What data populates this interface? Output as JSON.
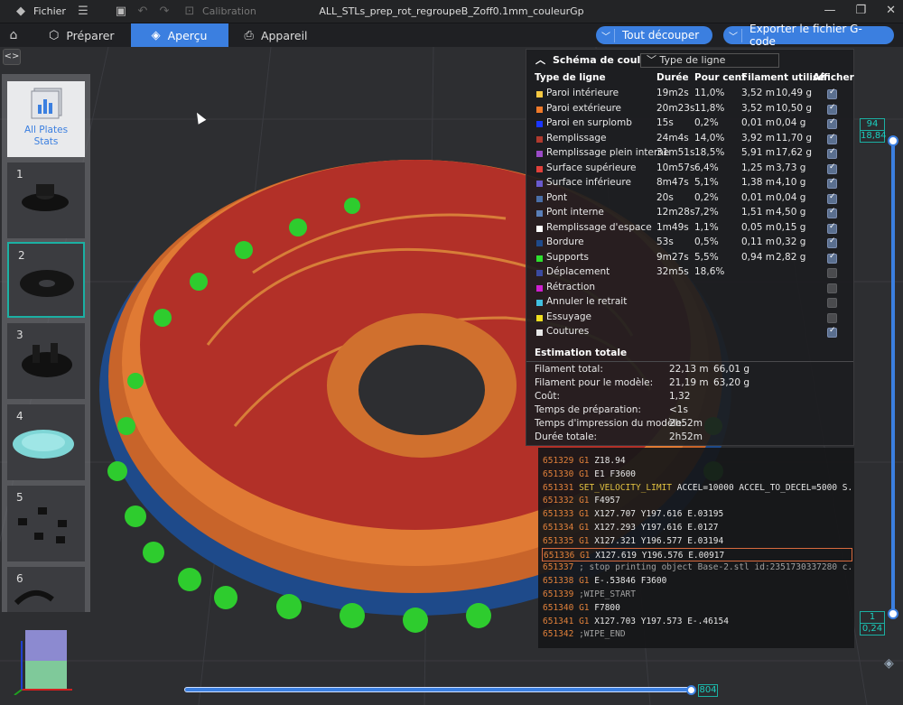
{
  "titlebar": {
    "menu_label": "Fichier",
    "calibration_label": "Calibration",
    "window_title": "ALL_STLs_prep_rot_regroupeB_Zoff0.1mm_couleurGp"
  },
  "tabs": [
    {
      "label": "Préparer",
      "icon": "cube-icon"
    },
    {
      "label": "Aperçu",
      "icon": "layers-icon"
    },
    {
      "label": "Appareil",
      "icon": "printer-icon"
    }
  ],
  "actions": {
    "slice_all": "Tout découper",
    "export_gcode": "Exporter le fichier G-code"
  },
  "plates": {
    "stats_label_1": "All Plates",
    "stats_label_2": "Stats",
    "items": [
      "1",
      "2",
      "3",
      "4",
      "5",
      "6"
    ],
    "selected": "2"
  },
  "legend": {
    "title": "Schéma de couleur",
    "view_mode": "Type de ligne",
    "columns": [
      "Type de ligne",
      "Durée",
      "Pour cent",
      "Filament utilisé",
      "Afficher"
    ],
    "rows": [
      {
        "name": "Paroi intérieure",
        "color": "#f5c842",
        "time": "19m2s",
        "pct": "11,0%",
        "len": "3,52 m",
        "weight": "10,49 g",
        "shown": true
      },
      {
        "name": "Paroi extérieure",
        "color": "#f07a2a",
        "time": "20m23s",
        "pct": "11,8%",
        "len": "3,52 m",
        "weight": "10,50 g",
        "shown": true
      },
      {
        "name": "Paroi en surplomb",
        "color": "#1a36ff",
        "time": "15s",
        "pct": "0,2%",
        "len": "0,01 m",
        "weight": "0,04 g",
        "shown": true
      },
      {
        "name": "Remplissage",
        "color": "#b03a2e",
        "time": "24m4s",
        "pct": "14,0%",
        "len": "3,92 m",
        "weight": "11,70 g",
        "shown": true
      },
      {
        "name": "Remplissage plein interne",
        "color": "#9a4ac6",
        "time": "31m51s",
        "pct": "18,5%",
        "len": "5,91 m",
        "weight": "17,62 g",
        "shown": true
      },
      {
        "name": "Surface supérieure",
        "color": "#e0403a",
        "time": "10m57s",
        "pct": "6,4%",
        "len": "1,25 m",
        "weight": "3,73 g",
        "shown": true
      },
      {
        "name": "Surface inférieure",
        "color": "#6a5acd",
        "time": "8m47s",
        "pct": "5,1%",
        "len": "1,38 m",
        "weight": "4,10 g",
        "shown": true
      },
      {
        "name": "Pont",
        "color": "#4a6fa8",
        "time": "20s",
        "pct": "0,2%",
        "len": "0,01 m",
        "weight": "0,04 g",
        "shown": true
      },
      {
        "name": "Pont interne",
        "color": "#5a7fb8",
        "time": "12m28s",
        "pct": "7,2%",
        "len": "1,51 m",
        "weight": "4,50 g",
        "shown": true
      },
      {
        "name": "Remplissage d'espace",
        "color": "#ffffff",
        "time": "1m49s",
        "pct": "1,1%",
        "len": "0,05 m",
        "weight": "0,15 g",
        "shown": true
      },
      {
        "name": "Bordure",
        "color": "#1e4a8a",
        "time": "53s",
        "pct": "0,5%",
        "len": "0,11 m",
        "weight": "0,32 g",
        "shown": true
      },
      {
        "name": "Supports",
        "color": "#2ee02e",
        "time": "9m27s",
        "pct": "5,5%",
        "len": "0,94 m",
        "weight": "2,82 g",
        "shown": true
      },
      {
        "name": "Déplacement",
        "color": "#3a4aa0",
        "time": "32m5s",
        "pct": "18,6%",
        "len": "",
        "weight": "",
        "shown": false
      },
      {
        "name": "Rétraction",
        "color": "#d020d0",
        "time": "",
        "pct": "",
        "len": "",
        "weight": "",
        "shown": false
      },
      {
        "name": "Annuler le retrait",
        "color": "#40c0e0",
        "time": "",
        "pct": "",
        "len": "",
        "weight": "",
        "shown": false
      },
      {
        "name": "Essuyage",
        "color": "#f0e020",
        "time": "",
        "pct": "",
        "len": "",
        "weight": "",
        "shown": false
      },
      {
        "name": "Coutures",
        "color": "#e8e8e8",
        "time": "",
        "pct": "",
        "len": "",
        "weight": "",
        "shown": true
      }
    ],
    "estimate_title": "Estimation totale",
    "estimates": [
      {
        "label": "Filament total:",
        "v1": "22,13 m",
        "v2": "66,01 g"
      },
      {
        "label": "Filament pour le modèle:",
        "v1": "21,19 m",
        "v2": "63,20 g"
      },
      {
        "label": "Coût:",
        "v1": "1,32",
        "v2": ""
      },
      {
        "label": "Temps de préparation:",
        "v1": "<1s",
        "v2": ""
      },
      {
        "label": "Temps d'impression du modèle:",
        "v1": "2h52m",
        "v2": ""
      },
      {
        "label": "Durée totale:",
        "v1": "2h52m",
        "v2": ""
      }
    ]
  },
  "gcode": [
    {
      "ln": "651329",
      "cmd": "G1",
      "args": "Z18.94",
      "type": "g"
    },
    {
      "ln": "651330",
      "cmd": "G1",
      "args": "E1 F3600",
      "type": "g"
    },
    {
      "ln": "651331",
      "cmd": "SET_VELOCITY_LIMIT",
      "args": "ACCEL=10000 ACCEL_TO_DECEL=5000 S...",
      "type": "set"
    },
    {
      "ln": "651332",
      "cmd": "G1",
      "args": "F4957",
      "type": "g"
    },
    {
      "ln": "651333",
      "cmd": "G1",
      "args": "X127.707 Y197.616 E.03195",
      "type": "g"
    },
    {
      "ln": "651334",
      "cmd": "G1",
      "args": "X127.293 Y197.616 E.0127",
      "type": "g"
    },
    {
      "ln": "651335",
      "cmd": "G1",
      "args": "X127.321 Y196.577 E.03194",
      "type": "g"
    },
    {
      "ln": "651336",
      "cmd": "G1",
      "args": "X127.619 Y196.576 E.00917",
      "type": "g",
      "highlight": true
    },
    {
      "ln": "651337",
      "cmd": "",
      "args": "; stop printing object Base-2.stl id:2351730337280 c...",
      "type": "cmt"
    },
    {
      "ln": "651338",
      "cmd": "G1",
      "args": "E-.53846 F3600",
      "type": "g"
    },
    {
      "ln": "651339",
      "cmd": "",
      "args": ";WIPE_START",
      "type": "cmt"
    },
    {
      "ln": "651340",
      "cmd": "G1",
      "args": "F7800",
      "type": "g"
    },
    {
      "ln": "651341",
      "cmd": "G1",
      "args": "X127.703 Y197.573 E-.46154",
      "type": "g"
    },
    {
      "ln": "651342",
      "cmd": "",
      "args": ";WIPE_END",
      "type": "cmt"
    }
  ],
  "layer_slider": {
    "top_layer": "94",
    "top_height": "18,84",
    "bottom_layer": "1",
    "bottom_height": "0,24"
  },
  "move_slider": {
    "value": "804"
  }
}
